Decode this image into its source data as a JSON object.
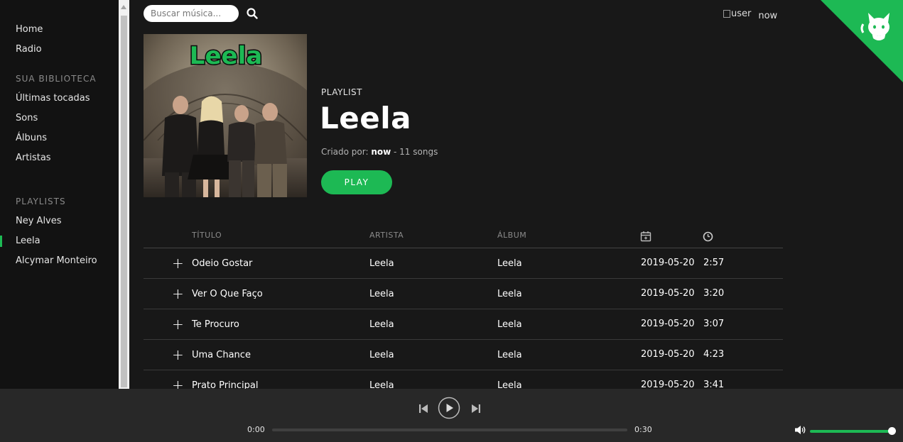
{
  "sidebar": {
    "nav": [
      "Home",
      "Radio"
    ],
    "library_title": "SUA BIBLIOTECA",
    "library": [
      "Últimas tocadas",
      "Sons",
      "Álbuns",
      "Artistas"
    ],
    "playlists_title": "PLAYLISTS",
    "playlists": [
      "Ney Alves",
      "Leela",
      "Alcymar Monteiro"
    ],
    "active_playlist": "Leela"
  },
  "header": {
    "search_placeholder": "Buscar música...",
    "user_img_alt": "user",
    "user_name": "now"
  },
  "playlist": {
    "kind": "PLAYLIST",
    "title": "Leela",
    "cover_logo": "Leela",
    "created_prefix": "Criado por:",
    "owner": "now",
    "songs_suffix": " - 11 songs",
    "play_label": "PLAY"
  },
  "table": {
    "headers": {
      "title": "TÍTULO",
      "artist": "ARTISTA",
      "album": "ÁLBUM"
    },
    "rows": [
      {
        "title": "Odeio Gostar",
        "artist": "Leela",
        "album": "Leela",
        "date": "2019-05-20",
        "duration": "2:57"
      },
      {
        "title": "Ver O Que Faço",
        "artist": "Leela",
        "album": "Leela",
        "date": "2019-05-20",
        "duration": "3:20"
      },
      {
        "title": "Te Procuro",
        "artist": "Leela",
        "album": "Leela",
        "date": "2019-05-20",
        "duration": "3:07"
      },
      {
        "title": "Uma Chance",
        "artist": "Leela",
        "album": "Leela",
        "date": "2019-05-20",
        "duration": "4:23"
      },
      {
        "title": "Prato Principal",
        "artist": "Leela",
        "album": "Leela",
        "date": "2019-05-20",
        "duration": "3:41"
      }
    ]
  },
  "player": {
    "current_time": "0:00",
    "total_time": "0:30",
    "progress": 0,
    "volume": 1.0
  },
  "colors": {
    "accent": "#1db954",
    "background": "#181818",
    "sidebar": "#121212",
    "player": "#282828"
  }
}
